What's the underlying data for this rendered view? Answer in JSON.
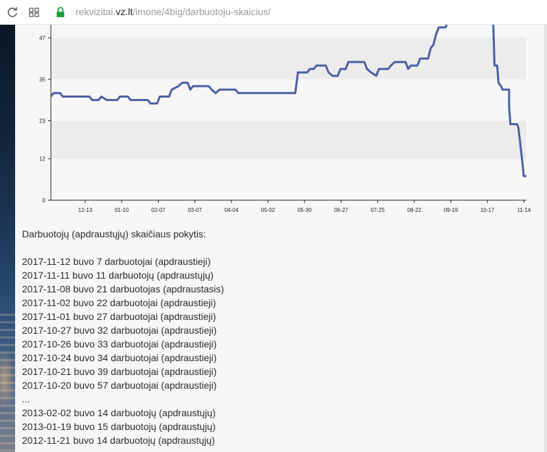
{
  "browser": {
    "url_prefix": "rekvizitai.",
    "url_host": "vz.lt",
    "url_path": "/imone/4big/darbuotoju-skaicius/"
  },
  "chart_data": {
    "type": "line",
    "title": "",
    "xlabel": "",
    "ylabel": "",
    "x_ticks": [
      "12-13",
      "01-10",
      "02-07",
      "03-07",
      "04-04",
      "05-02",
      "05-30",
      "06-27",
      "07-25",
      "08-22",
      "09-19",
      "10-17",
      "11-14"
    ],
    "y_ticks": [
      0,
      12,
      23,
      35,
      47
    ],
    "ylim": [
      0,
      50
    ],
    "x_domain": [
      "2016-11-21",
      "2017-11-14"
    ],
    "grid": "horizontal bands",
    "series": [
      {
        "color": "#4a5fa3",
        "points": [
          [
            "2016-11-21",
            30
          ],
          [
            "2016-11-23",
            31
          ],
          [
            "2016-11-28",
            31
          ],
          [
            "2016-11-30",
            30
          ],
          [
            "2016-12-20",
            30
          ],
          [
            "2016-12-22",
            29
          ],
          [
            "2016-12-27",
            29
          ],
          [
            "2016-12-29",
            30
          ],
          [
            "2017-01-02",
            29
          ],
          [
            "2017-01-10",
            29
          ],
          [
            "2017-01-12",
            30
          ],
          [
            "2017-01-18",
            30
          ],
          [
            "2017-01-20",
            29
          ],
          [
            "2017-02-02",
            29
          ],
          [
            "2017-02-04",
            28
          ],
          [
            "2017-02-09",
            28
          ],
          [
            "2017-02-11",
            30
          ],
          [
            "2017-02-18",
            30
          ],
          [
            "2017-02-20",
            32
          ],
          [
            "2017-02-25",
            33
          ],
          [
            "2017-02-28",
            34
          ],
          [
            "2017-03-04",
            34
          ],
          [
            "2017-03-06",
            32
          ],
          [
            "2017-03-08",
            33
          ],
          [
            "2017-03-20",
            33
          ],
          [
            "2017-03-22",
            32
          ],
          [
            "2017-03-25",
            31
          ],
          [
            "2017-03-28",
            32
          ],
          [
            "2017-04-09",
            32
          ],
          [
            "2017-04-11",
            31
          ],
          [
            "2017-05-24",
            31
          ],
          [
            "2017-05-26",
            37
          ],
          [
            "2017-06-02",
            37
          ],
          [
            "2017-06-04",
            38
          ],
          [
            "2017-06-07",
            38
          ],
          [
            "2017-06-09",
            39
          ],
          [
            "2017-06-16",
            39
          ],
          [
            "2017-06-18",
            37
          ],
          [
            "2017-06-21",
            36
          ],
          [
            "2017-06-25",
            36
          ],
          [
            "2017-06-27",
            38
          ],
          [
            "2017-07-01",
            38
          ],
          [
            "2017-07-03",
            40
          ],
          [
            "2017-07-15",
            40
          ],
          [
            "2017-07-17",
            38
          ],
          [
            "2017-07-20",
            37
          ],
          [
            "2017-07-24",
            36
          ],
          [
            "2017-07-26",
            38
          ],
          [
            "2017-08-02",
            38
          ],
          [
            "2017-08-04",
            39
          ],
          [
            "2017-08-07",
            40
          ],
          [
            "2017-08-15",
            40
          ],
          [
            "2017-08-17",
            38
          ],
          [
            "2017-08-19",
            39
          ],
          [
            "2017-08-24",
            39
          ],
          [
            "2017-08-26",
            41
          ],
          [
            "2017-09-01",
            41
          ],
          [
            "2017-09-03",
            44
          ],
          [
            "2017-09-05",
            45
          ],
          [
            "2017-09-07",
            48
          ],
          [
            "2017-09-09",
            50
          ],
          [
            "2017-09-14",
            50
          ],
          [
            "2017-09-16",
            52
          ],
          [
            "2017-10-20",
            57
          ],
          [
            "2017-10-21",
            39
          ],
          [
            "2017-10-23",
            39
          ],
          [
            "2017-10-24",
            34
          ],
          [
            "2017-10-26",
            33
          ],
          [
            "2017-10-27",
            32
          ],
          [
            "2017-11-01",
            32
          ],
          [
            "2017-11-01",
            27
          ],
          [
            "2017-11-02",
            22
          ],
          [
            "2017-11-07",
            22
          ],
          [
            "2017-11-08",
            21
          ],
          [
            "2017-11-11",
            11
          ],
          [
            "2017-11-12",
            7
          ],
          [
            "2017-11-14",
            7
          ]
        ]
      }
    ]
  },
  "history": {
    "heading": "Darbuotojų (apdraustųjų) skaičiaus pokytis:",
    "rows": [
      "2017-11-12 buvo 7 darbuotojai (apdraustieji)",
      "2017-11-11 buvo 11 darbuotojų (apdraustųjų)",
      "2017-11-08 buvo 21 darbuotojas (apdraustasis)",
      "2017-11-02 buvo 22 darbuotojai (apdraustieji)",
      "2017-11-01 buvo 27 darbuotojai (apdraustieji)",
      "2017-10-27 buvo 32 darbuotojai (apdraustieji)",
      "2017-10-26 buvo 33 darbuotojai (apdraustieji)",
      "2017-10-24 buvo 34 darbuotojai (apdraustieji)",
      "2017-10-21 buvo 39 darbuotojai (apdraustieji)",
      "2017-10-20 buvo 57 darbuotojai (apdraustieji)",
      "...",
      "2013-02-02 buvo 14 darbuotojų (apdraustųjų)",
      "2013-01-19 buvo 15 darbuotojų (apdraustųjų)",
      "2012-11-21 buvo 14 darbuotojų (apdraustųjų)"
    ]
  }
}
